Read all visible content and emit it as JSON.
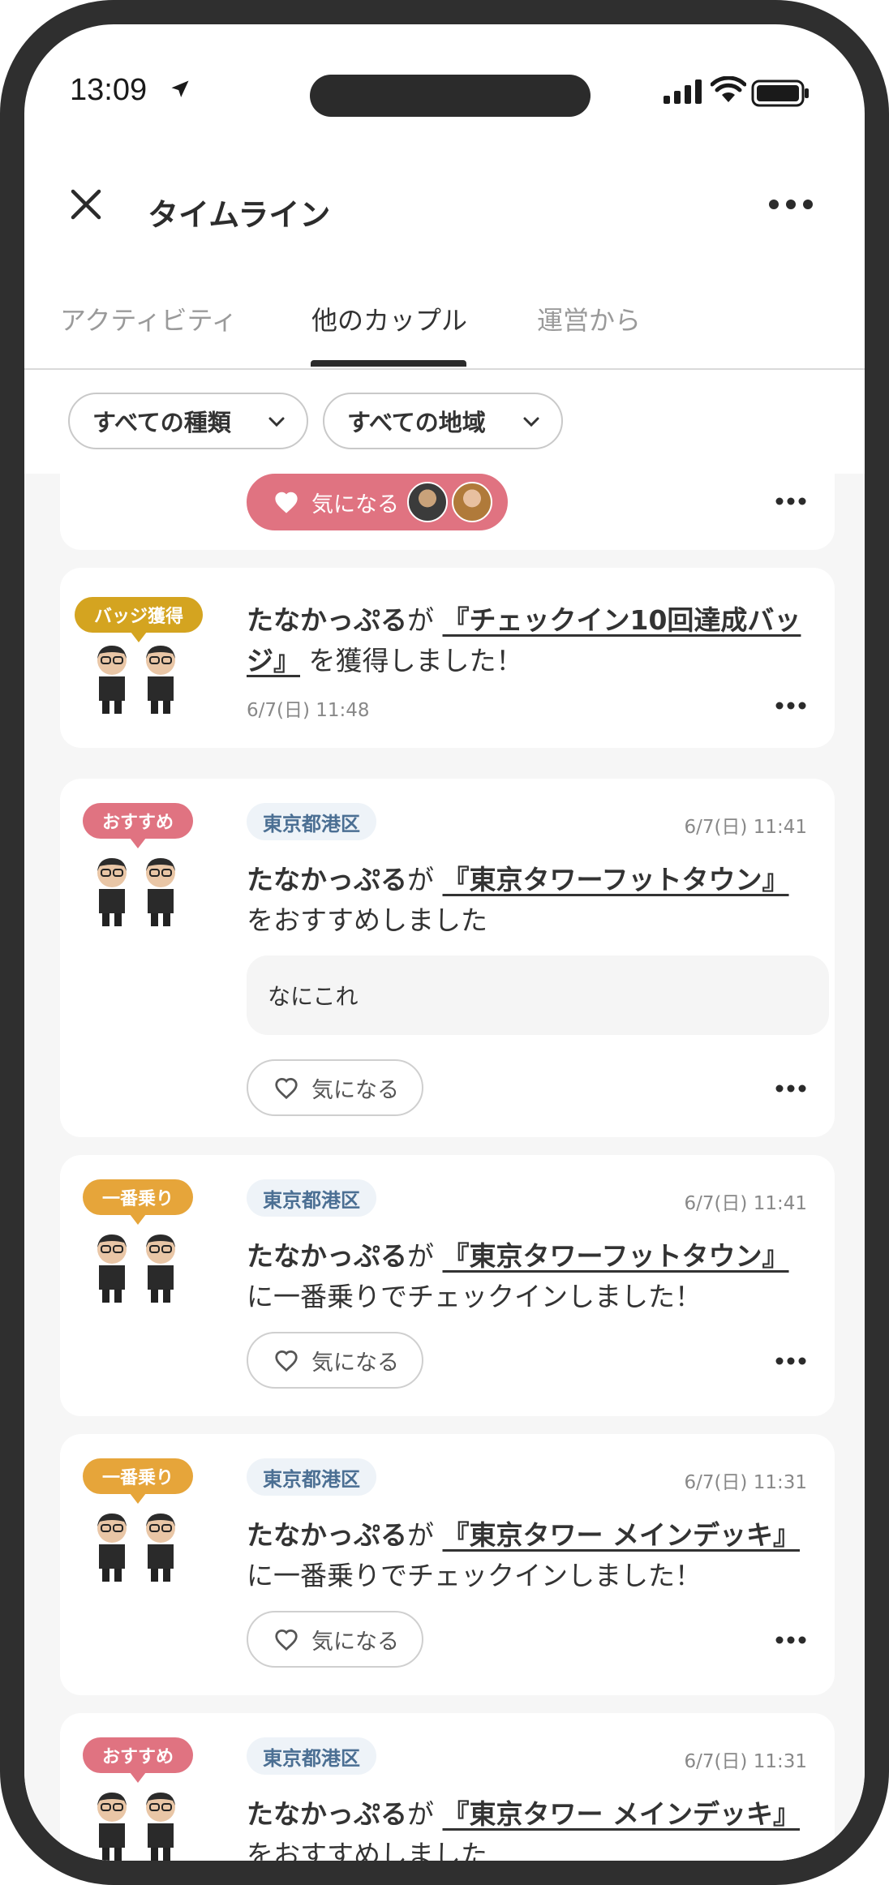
{
  "status": {
    "time": "13:09"
  },
  "header": {
    "title": "タイムライン"
  },
  "tabs": [
    {
      "label": "アクティビティ"
    },
    {
      "label": "他のカップル"
    },
    {
      "label": "運営から"
    }
  ],
  "filters": {
    "type": "すべての種類",
    "region": "すべての地域"
  },
  "like_label": "気になる",
  "feed": [
    {
      "badge": "バッジ獲得",
      "user": "たなかっぷる",
      "particle": "が",
      "link_1": "『チェックイン10回達成バッ",
      "link_2": "ジ』",
      "rest": "を獲得しました！",
      "date": "6/7(日) 11:48"
    },
    {
      "badge": "おすすめ",
      "region": "東京都港区",
      "date": "6/7(日) 11:41",
      "user": "たなかっぷる",
      "particle": "が",
      "link": "『東京タワーフットタウン』",
      "rest": "をおすすめしました",
      "memo": "なにこれ"
    },
    {
      "badge": "一番乗り",
      "region": "東京都港区",
      "date": "6/7(日) 11:41",
      "user": "たなかっぷる",
      "particle": "が",
      "link": "『東京タワーフットタウン』",
      "rest": "に一番乗りでチェックインしました！"
    },
    {
      "badge": "一番乗り",
      "region": "東京都港区",
      "date": "6/7(日) 11:31",
      "user": "たなかっぷる",
      "particle": "が",
      "link": "『東京タワー メインデッキ』",
      "rest": "に一番乗りでチェックインしました！"
    },
    {
      "badge": "おすすめ",
      "region": "東京都港区",
      "date": "6/7(日) 11:31",
      "user": "たなかっぷる",
      "particle": "が",
      "link": "『東京タワー メインデッキ』",
      "rest": "をおすすめしました"
    }
  ],
  "colors": {
    "accent_pink": "#e07381",
    "badge_orange": "#e6a53a",
    "badge_gold": "#d4a420",
    "region_text": "#4b6f93"
  }
}
